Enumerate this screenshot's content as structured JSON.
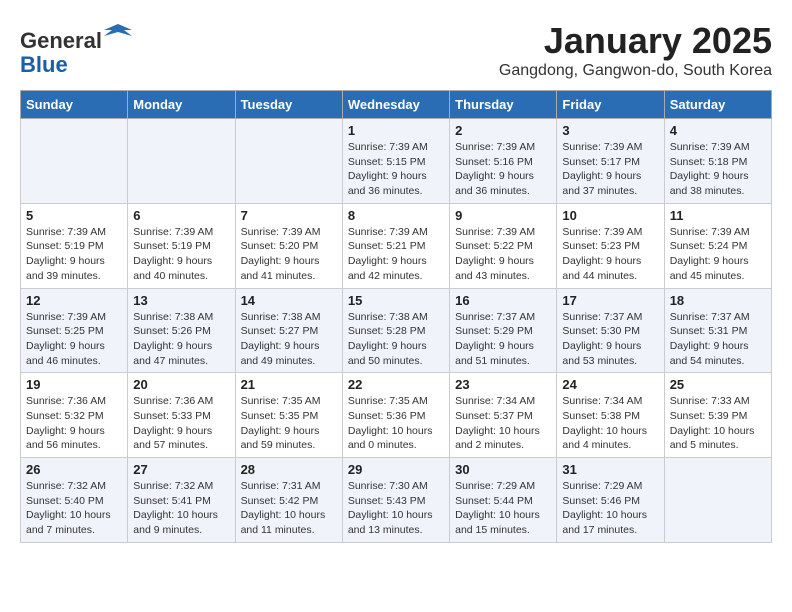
{
  "logo": {
    "general": "General",
    "blue": "Blue"
  },
  "title": "January 2025",
  "subtitle": "Gangdong, Gangwon-do, South Korea",
  "weekdays": [
    "Sunday",
    "Monday",
    "Tuesday",
    "Wednesday",
    "Thursday",
    "Friday",
    "Saturday"
  ],
  "weeks": [
    [
      {
        "day": "",
        "info": ""
      },
      {
        "day": "",
        "info": ""
      },
      {
        "day": "",
        "info": ""
      },
      {
        "day": "1",
        "info": "Sunrise: 7:39 AM\nSunset: 5:15 PM\nDaylight: 9 hours\nand 36 minutes."
      },
      {
        "day": "2",
        "info": "Sunrise: 7:39 AM\nSunset: 5:16 PM\nDaylight: 9 hours\nand 36 minutes."
      },
      {
        "day": "3",
        "info": "Sunrise: 7:39 AM\nSunset: 5:17 PM\nDaylight: 9 hours\nand 37 minutes."
      },
      {
        "day": "4",
        "info": "Sunrise: 7:39 AM\nSunset: 5:18 PM\nDaylight: 9 hours\nand 38 minutes."
      }
    ],
    [
      {
        "day": "5",
        "info": "Sunrise: 7:39 AM\nSunset: 5:19 PM\nDaylight: 9 hours\nand 39 minutes."
      },
      {
        "day": "6",
        "info": "Sunrise: 7:39 AM\nSunset: 5:19 PM\nDaylight: 9 hours\nand 40 minutes."
      },
      {
        "day": "7",
        "info": "Sunrise: 7:39 AM\nSunset: 5:20 PM\nDaylight: 9 hours\nand 41 minutes."
      },
      {
        "day": "8",
        "info": "Sunrise: 7:39 AM\nSunset: 5:21 PM\nDaylight: 9 hours\nand 42 minutes."
      },
      {
        "day": "9",
        "info": "Sunrise: 7:39 AM\nSunset: 5:22 PM\nDaylight: 9 hours\nand 43 minutes."
      },
      {
        "day": "10",
        "info": "Sunrise: 7:39 AM\nSunset: 5:23 PM\nDaylight: 9 hours\nand 44 minutes."
      },
      {
        "day": "11",
        "info": "Sunrise: 7:39 AM\nSunset: 5:24 PM\nDaylight: 9 hours\nand 45 minutes."
      }
    ],
    [
      {
        "day": "12",
        "info": "Sunrise: 7:39 AM\nSunset: 5:25 PM\nDaylight: 9 hours\nand 46 minutes."
      },
      {
        "day": "13",
        "info": "Sunrise: 7:38 AM\nSunset: 5:26 PM\nDaylight: 9 hours\nand 47 minutes."
      },
      {
        "day": "14",
        "info": "Sunrise: 7:38 AM\nSunset: 5:27 PM\nDaylight: 9 hours\nand 49 minutes."
      },
      {
        "day": "15",
        "info": "Sunrise: 7:38 AM\nSunset: 5:28 PM\nDaylight: 9 hours\nand 50 minutes."
      },
      {
        "day": "16",
        "info": "Sunrise: 7:37 AM\nSunset: 5:29 PM\nDaylight: 9 hours\nand 51 minutes."
      },
      {
        "day": "17",
        "info": "Sunrise: 7:37 AM\nSunset: 5:30 PM\nDaylight: 9 hours\nand 53 minutes."
      },
      {
        "day": "18",
        "info": "Sunrise: 7:37 AM\nSunset: 5:31 PM\nDaylight: 9 hours\nand 54 minutes."
      }
    ],
    [
      {
        "day": "19",
        "info": "Sunrise: 7:36 AM\nSunset: 5:32 PM\nDaylight: 9 hours\nand 56 minutes."
      },
      {
        "day": "20",
        "info": "Sunrise: 7:36 AM\nSunset: 5:33 PM\nDaylight: 9 hours\nand 57 minutes."
      },
      {
        "day": "21",
        "info": "Sunrise: 7:35 AM\nSunset: 5:35 PM\nDaylight: 9 hours\nand 59 minutes."
      },
      {
        "day": "22",
        "info": "Sunrise: 7:35 AM\nSunset: 5:36 PM\nDaylight: 10 hours\nand 0 minutes."
      },
      {
        "day": "23",
        "info": "Sunrise: 7:34 AM\nSunset: 5:37 PM\nDaylight: 10 hours\nand 2 minutes."
      },
      {
        "day": "24",
        "info": "Sunrise: 7:34 AM\nSunset: 5:38 PM\nDaylight: 10 hours\nand 4 minutes."
      },
      {
        "day": "25",
        "info": "Sunrise: 7:33 AM\nSunset: 5:39 PM\nDaylight: 10 hours\nand 5 minutes."
      }
    ],
    [
      {
        "day": "26",
        "info": "Sunrise: 7:32 AM\nSunset: 5:40 PM\nDaylight: 10 hours\nand 7 minutes."
      },
      {
        "day": "27",
        "info": "Sunrise: 7:32 AM\nSunset: 5:41 PM\nDaylight: 10 hours\nand 9 minutes."
      },
      {
        "day": "28",
        "info": "Sunrise: 7:31 AM\nSunset: 5:42 PM\nDaylight: 10 hours\nand 11 minutes."
      },
      {
        "day": "29",
        "info": "Sunrise: 7:30 AM\nSunset: 5:43 PM\nDaylight: 10 hours\nand 13 minutes."
      },
      {
        "day": "30",
        "info": "Sunrise: 7:29 AM\nSunset: 5:44 PM\nDaylight: 10 hours\nand 15 minutes."
      },
      {
        "day": "31",
        "info": "Sunrise: 7:29 AM\nSunset: 5:46 PM\nDaylight: 10 hours\nand 17 minutes."
      },
      {
        "day": "",
        "info": ""
      }
    ]
  ]
}
